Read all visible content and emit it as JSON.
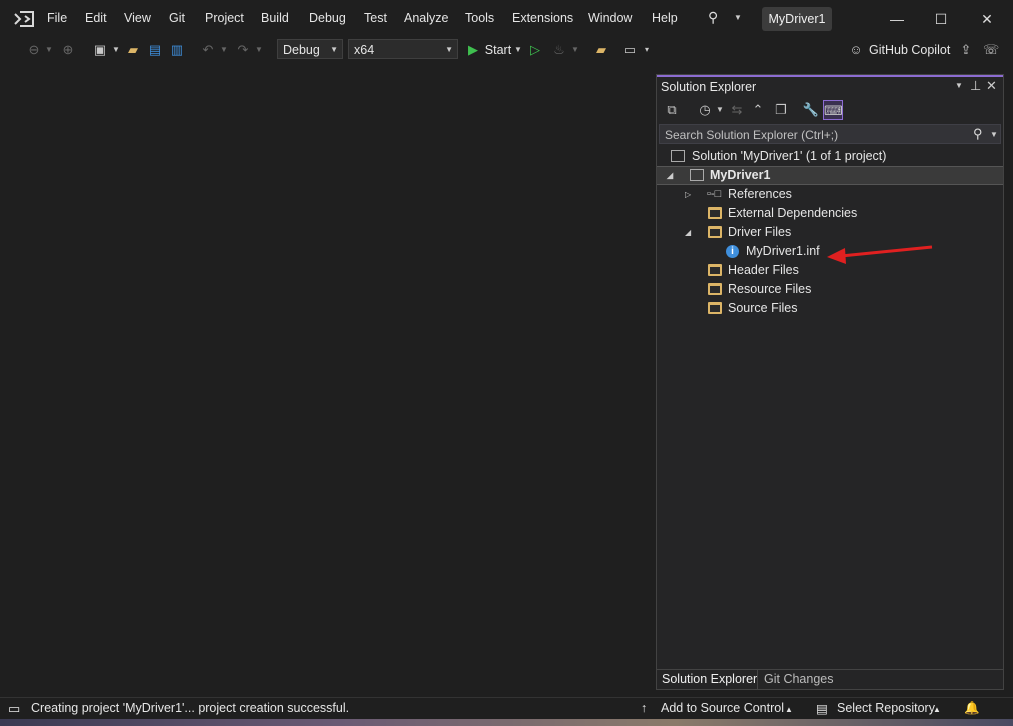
{
  "menu": [
    "File",
    "Edit",
    "View",
    "Git",
    "Project",
    "Build",
    "Debug",
    "Test",
    "Analyze",
    "Tools",
    "Extensions",
    "Window",
    "Help"
  ],
  "window_title": "MyDriver1",
  "toolbar": {
    "config": "Debug",
    "platform": "x64",
    "start_label": "Start",
    "copilot_label": "GitHub Copilot"
  },
  "solution_explorer": {
    "title": "Solution Explorer",
    "search_placeholder": "Search Solution Explorer (Ctrl+;)",
    "solution_label": "Solution 'MyDriver1' (1 of 1 project)",
    "project_label": "MyDriver1",
    "items": {
      "references": "References",
      "external_deps": "External Dependencies",
      "driver_files": "Driver Files",
      "inf_file": "MyDriver1.inf",
      "header_files": "Header Files",
      "resource_files": "Resource Files",
      "source_files": "Source Files"
    },
    "tabs": [
      "Solution Explorer",
      "Git Changes"
    ]
  },
  "status": {
    "message": "Creating project 'MyDriver1'... project creation successful.",
    "source_control": "Add to Source Control",
    "repository": "Select Repository"
  },
  "colors": {
    "accent": "#8c6cd2",
    "annotation_arrow": "#e02020",
    "folder": "#dcb567",
    "info": "#3f8fdc"
  }
}
